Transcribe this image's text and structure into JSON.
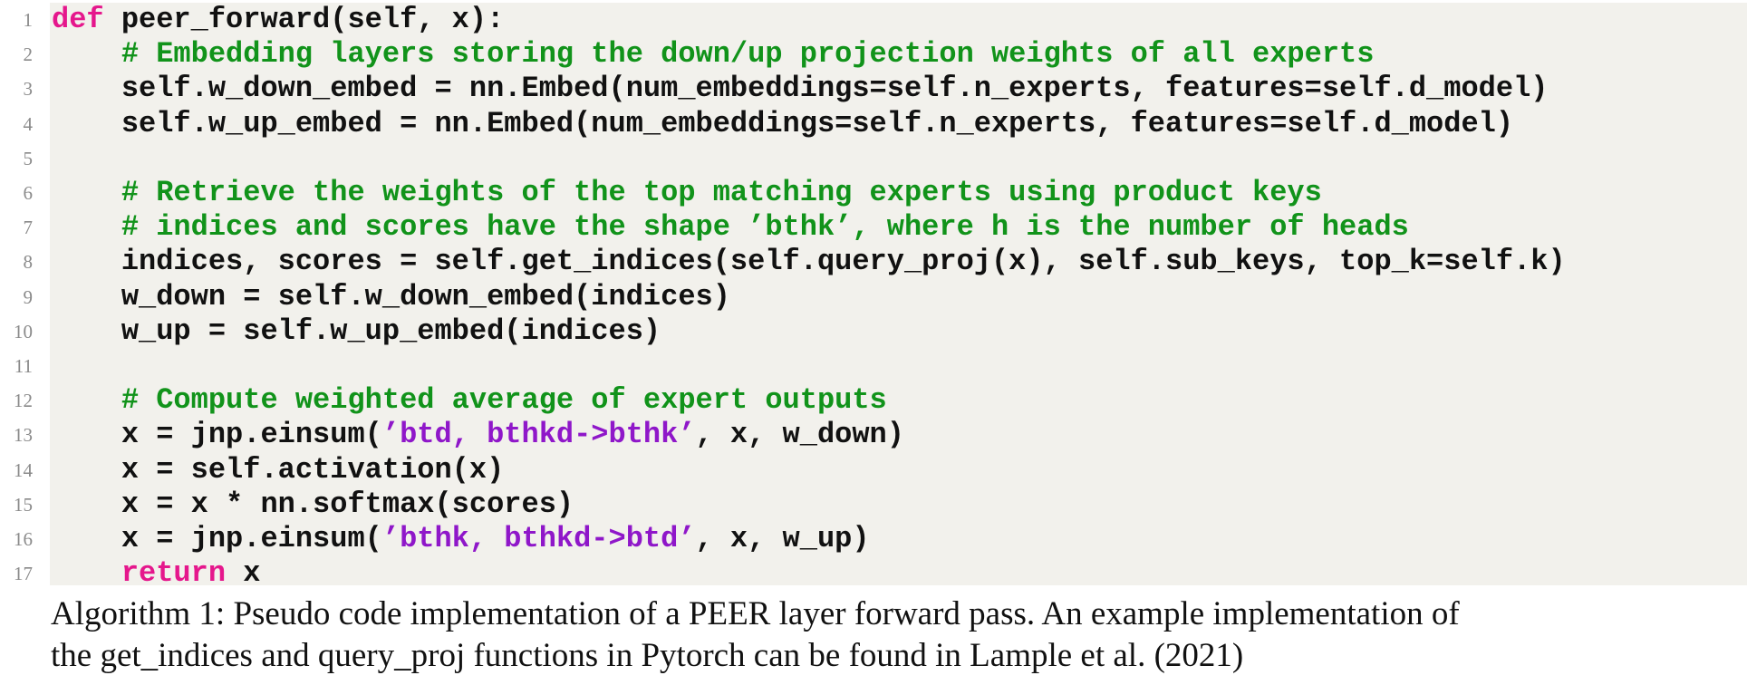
{
  "listing": {
    "lines": [
      {
        "n": "1",
        "parts": [
          {
            "t": "def",
            "c": "kw"
          },
          {
            "t": " peer_forward(self, x):",
            "c": ""
          }
        ]
      },
      {
        "n": "2",
        "parts": [
          {
            "t": "    ",
            "c": ""
          },
          {
            "t": "# Embedding layers storing the down/up projection weights of all experts",
            "c": "cm"
          }
        ]
      },
      {
        "n": "3",
        "parts": [
          {
            "t": "    self.w_down_embed = nn.Embed(num_embeddings=self.n_experts, features=self.d_model)",
            "c": ""
          }
        ]
      },
      {
        "n": "4",
        "parts": [
          {
            "t": "    self.w_up_embed = nn.Embed(num_embeddings=self.n_experts, features=self.d_model)",
            "c": ""
          }
        ]
      },
      {
        "n": "5",
        "parts": []
      },
      {
        "n": "6",
        "parts": [
          {
            "t": "    ",
            "c": ""
          },
          {
            "t": "# Retrieve the weights of the top matching experts using product keys",
            "c": "cm"
          }
        ]
      },
      {
        "n": "7",
        "parts": [
          {
            "t": "    ",
            "c": ""
          },
          {
            "t": "# indices and scores have the shape ’bthk’, where h is the number of heads",
            "c": "cm"
          }
        ]
      },
      {
        "n": "8",
        "parts": [
          {
            "t": "    indices, scores = self.get_indices(self.query_proj(x), self.sub_keys, top_k=self.k)",
            "c": ""
          }
        ]
      },
      {
        "n": "9",
        "parts": [
          {
            "t": "    w_down = self.w_down_embed(indices)",
            "c": ""
          }
        ]
      },
      {
        "n": "10",
        "parts": [
          {
            "t": "    w_up = self.w_up_embed(indices)",
            "c": ""
          }
        ]
      },
      {
        "n": "11",
        "parts": []
      },
      {
        "n": "12",
        "parts": [
          {
            "t": "    ",
            "c": ""
          },
          {
            "t": "# Compute weighted average of expert outputs",
            "c": "cm"
          }
        ]
      },
      {
        "n": "13",
        "parts": [
          {
            "t": "    x = jnp.einsum(",
            "c": ""
          },
          {
            "t": "’btd, bthkd->bthk’",
            "c": "st"
          },
          {
            "t": ", x, w_down)",
            "c": ""
          }
        ]
      },
      {
        "n": "14",
        "parts": [
          {
            "t": "    x = self.activation(x)",
            "c": ""
          }
        ]
      },
      {
        "n": "15",
        "parts": [
          {
            "t": "    x = x * nn.softmax(scores)",
            "c": ""
          }
        ]
      },
      {
        "n": "16",
        "parts": [
          {
            "t": "    x = jnp.einsum(",
            "c": ""
          },
          {
            "t": "’bthk, bthkd->btd’",
            "c": "st"
          },
          {
            "t": ", x, w_up)",
            "c": ""
          }
        ]
      },
      {
        "n": "17",
        "parts": [
          {
            "t": "    ",
            "c": ""
          },
          {
            "t": "return",
            "c": "kw"
          },
          {
            "t": " x",
            "c": ""
          }
        ]
      }
    ],
    "colors": {
      "keyword": "#e5178c",
      "comment": "#11931a",
      "string": "#8f17c9",
      "background": "#f2f1ec"
    }
  },
  "caption": {
    "line1": "Algorithm 1: Pseudo code implementation of a PEER layer forward pass.  An example implementation of",
    "line2": "the get_indices and query_proj functions in Pytorch can be found in Lample et al. (2021)"
  }
}
